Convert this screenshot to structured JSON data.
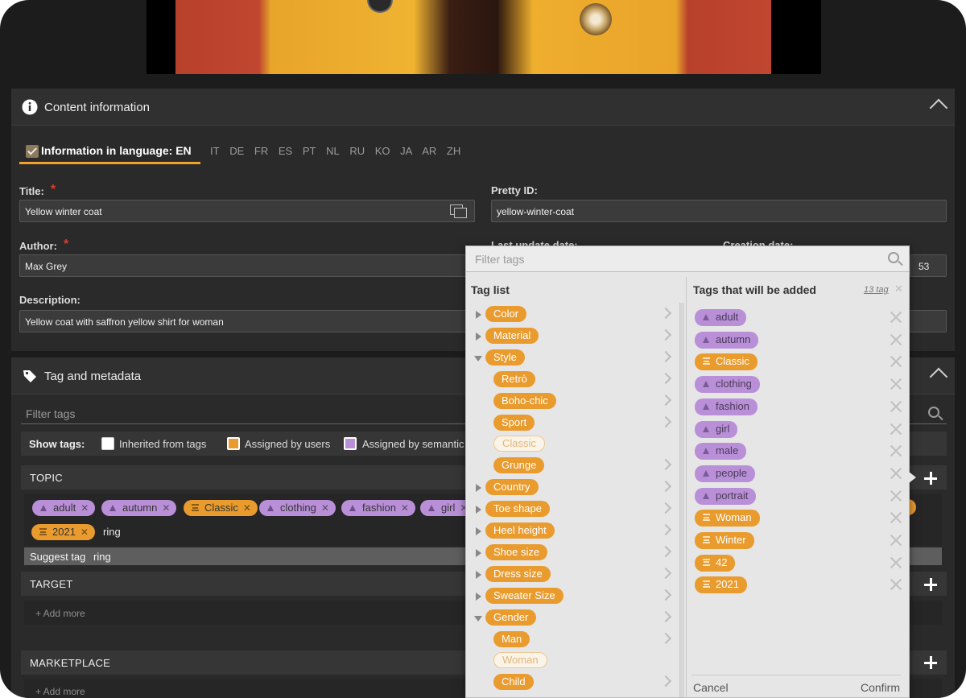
{
  "content_section": {
    "title": "Content information"
  },
  "language": {
    "active_label": "Information in language: EN",
    "codes": [
      "IT",
      "DE",
      "FR",
      "ES",
      "PT",
      "NL",
      "RU",
      "KO",
      "JA",
      "AR",
      "ZH"
    ]
  },
  "form": {
    "title_label": "Title:",
    "title_value": "Yellow winter coat",
    "pretty_id_label": "Pretty ID:",
    "pretty_id_value": "yellow-winter-coat",
    "author_label": "Author:",
    "author_value": "Max Grey",
    "last_update_label": "Last update date:",
    "creation_label": "Creation date:",
    "creation_value_partial": "53",
    "description_label": "Description:",
    "description_value": "Yellow coat with saffron yellow  shirt for woman",
    "required_mark": "*"
  },
  "tag_section": {
    "title": "Tag and metadata",
    "filter_placeholder": "Filter tags",
    "show_tags_label": "Show tags:",
    "show_options": [
      "Inherited from tags",
      "Assigned by users",
      "Assigned by semantic"
    ],
    "show_option_colors": [
      "#ffffff",
      "#e99b2e",
      "#b990d8"
    ]
  },
  "topic": {
    "label": "TOPIC",
    "chips": [
      {
        "text": "adult",
        "type": "semantic"
      },
      {
        "text": "autumn",
        "type": "semantic"
      },
      {
        "text": "Classic",
        "type": "user"
      },
      {
        "text": "clothing",
        "type": "semantic"
      },
      {
        "text": "fashion",
        "type": "semantic"
      },
      {
        "text": "girl",
        "type": "semantic"
      }
    ],
    "chip_2021": "2021",
    "chip_remove": "✕",
    "typed_text": "ring",
    "suggest_label": "Suggest tag",
    "suggest_value": "ring"
  },
  "target": {
    "label": "TARGET",
    "add_more": "+ Add more"
  },
  "marketplace": {
    "label": "MARKETPLACE",
    "add_more": "+ Add more"
  },
  "dropdown": {
    "filter_placeholder": "Filter tags",
    "tag_list_title": "Tag list",
    "added_title": "Tags that will be added",
    "count_label": "13 tag",
    "count_clear": "✕",
    "tag_list": [
      {
        "text": "Color",
        "level": 0,
        "expander": "right",
        "chevron": true
      },
      {
        "text": "Material",
        "level": 0,
        "expander": "right",
        "chevron": true
      },
      {
        "text": "Style",
        "level": 0,
        "expander": "down",
        "chevron": true
      },
      {
        "text": "Retrò",
        "level": 1,
        "expander": "",
        "chevron": true
      },
      {
        "text": "Boho-chic",
        "level": 1,
        "expander": "",
        "chevron": true
      },
      {
        "text": "Sport",
        "level": 1,
        "expander": "",
        "chevron": true
      },
      {
        "text": "Classic",
        "level": 1,
        "expander": "",
        "chevron": false,
        "ghost": true
      },
      {
        "text": "Grunge",
        "level": 1,
        "expander": "",
        "chevron": true
      },
      {
        "text": "Country",
        "level": 0,
        "expander": "right",
        "chevron": true
      },
      {
        "text": "Toe shape",
        "level": 0,
        "expander": "right",
        "chevron": true
      },
      {
        "text": "Heel height",
        "level": 0,
        "expander": "right",
        "chevron": true
      },
      {
        "text": "Shoe size",
        "level": 0,
        "expander": "right",
        "chevron": true
      },
      {
        "text": "Dress size",
        "level": 0,
        "expander": "right",
        "chevron": true
      },
      {
        "text": "Sweater Size",
        "level": 0,
        "expander": "right",
        "chevron": true
      },
      {
        "text": "Gender",
        "level": 0,
        "expander": "down",
        "chevron": true
      },
      {
        "text": "Man",
        "level": 1,
        "expander": "",
        "chevron": true
      },
      {
        "text": "Woman",
        "level": 1,
        "expander": "",
        "chevron": false,
        "ghost": true
      },
      {
        "text": "Child",
        "level": 1,
        "expander": "",
        "chevron": true
      }
    ],
    "added_tags": [
      {
        "text": "adult",
        "type": "semantic"
      },
      {
        "text": "autumn",
        "type": "semantic"
      },
      {
        "text": "Classic",
        "type": "user"
      },
      {
        "text": "clothing",
        "type": "semantic"
      },
      {
        "text": "fashion",
        "type": "semantic"
      },
      {
        "text": "girl",
        "type": "semantic"
      },
      {
        "text": "male",
        "type": "semantic"
      },
      {
        "text": "people",
        "type": "semantic"
      },
      {
        "text": "portrait",
        "type": "semantic"
      },
      {
        "text": "Woman",
        "type": "user"
      },
      {
        "text": "Winter",
        "type": "user"
      },
      {
        "text": "42",
        "type": "user"
      },
      {
        "text": "2021",
        "type": "user"
      }
    ],
    "cancel": "Cancel",
    "confirm": "Confirm"
  },
  "colors": {
    "accent": "#f0a22c",
    "user_tag": "#e99b2e",
    "semantic_tag": "#b990d8",
    "required": "#e2392d"
  }
}
